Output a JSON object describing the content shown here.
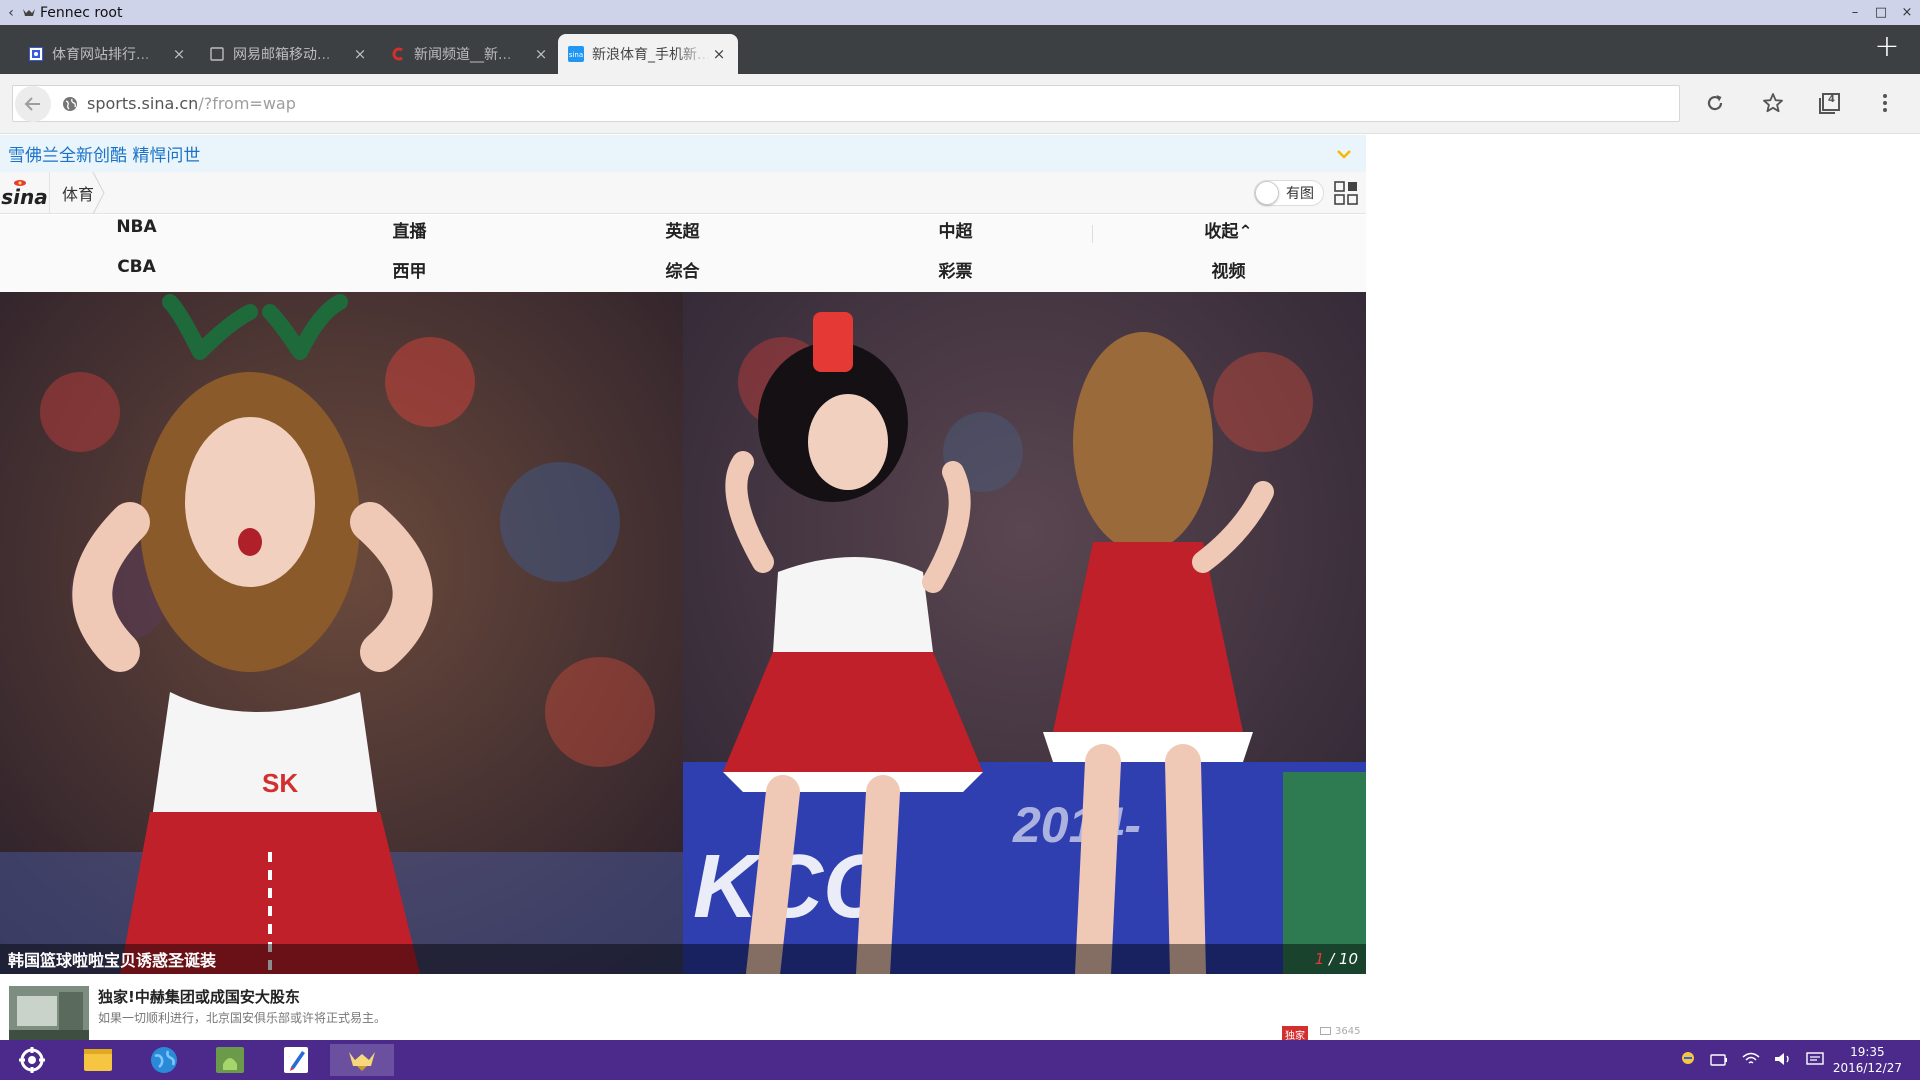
{
  "window": {
    "title": "Fennec root",
    "back_glyph": "‹",
    "controls": [
      "–",
      "□",
      "×"
    ]
  },
  "tabs": [
    {
      "label": "体育网站排行...",
      "favicon": "ranking-favicon",
      "active": false
    },
    {
      "label": "网易邮箱移动...",
      "favicon": "blank-page-favicon",
      "active": false
    },
    {
      "label": "新闻频道__新...",
      "favicon": "news-c-favicon",
      "active": false
    },
    {
      "label": "新浪体育_手机新...",
      "favicon": "sina-favicon",
      "active": true
    }
  ],
  "tab_close_glyph": "×",
  "new_tab_glyph": "+",
  "omnibox": {
    "url_host": "sports.sina.cn",
    "url_path": "/?from=wap",
    "tab_count": "4"
  },
  "page": {
    "ad_text": "雪佛兰全新创酷 精悍问世",
    "logo_text": "sina",
    "breadcrumb": "体育",
    "image_toggle_label": "有图",
    "nav": {
      "row1": [
        "NBA",
        "直播",
        "英超",
        "中超",
        "收起⌃"
      ],
      "row2": [
        "CBA",
        "西甲",
        "综合",
        "彩票",
        "视频"
      ]
    },
    "gallery": {
      "caption": "韩国篮球啦啦宝贝诱惑圣诞装",
      "current": "1",
      "total": "/ 10"
    },
    "news": {
      "title": "独家!中赫集团或成国安大股东",
      "desc": "如果一切顺利进行，北京国安俱乐部或许将正式易主。",
      "badge": "独家",
      "comments": "3645"
    }
  },
  "taskbar": {
    "time": "19:35",
    "date": "2016/12/27"
  },
  "colors": {
    "titlebar": "#cfd3ea",
    "tabstrip": "#3c4043",
    "taskbar": "#4b2a8c",
    "sina_link": "#1a73c9",
    "accent_red": "#d32f2f"
  }
}
